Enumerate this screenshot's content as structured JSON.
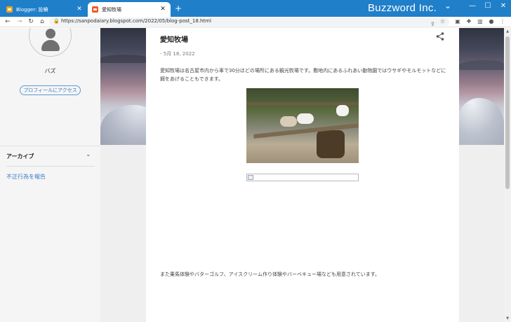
{
  "browser": {
    "tabs": [
      {
        "label": "Blogger: 投稿",
        "active": false
      },
      {
        "label": "愛知牧場",
        "active": true
      }
    ],
    "new_tab": "+",
    "brand": "Buzzword Inc.",
    "window_controls": {
      "chevron": "⌄",
      "minimize": "—",
      "maximize": "☐",
      "close": "✕"
    },
    "url": "https://sanpodaiary.blogspot.com/2022/05/blog-post_18.html",
    "icons": [
      "back-icon",
      "forward-icon",
      "reload-icon",
      "home-icon",
      "lock-icon",
      "share-icon",
      "star-icon",
      "extension-icon",
      "puzzle-icon",
      "sidepanel-icon",
      "profile-icon",
      "menu-icon"
    ]
  },
  "sidebar": {
    "profile_name": "バズ",
    "profile_button": "プロフィールにアクセス",
    "archive_title": "アーカイブ",
    "report_link": "不正行為を報告"
  },
  "post": {
    "title": "愛知牧場",
    "date": "- 5月 18, 2022",
    "paragraph1": "愛知牧場は名古屋市内から車で30分ほどの場所にある観光牧場です。敷地内にあるふれあい動物園ではウサギやモルモットなどに餌をあげることもできます。",
    "paragraph2": "また乗馬体験やバターゴルフ、アイスクリーム作り体験やバーベキュー場なども用意されています。"
  },
  "colors": {
    "tabbar": "#1f7fc9",
    "link": "#3a7bc8",
    "page_background": "#efefef"
  }
}
